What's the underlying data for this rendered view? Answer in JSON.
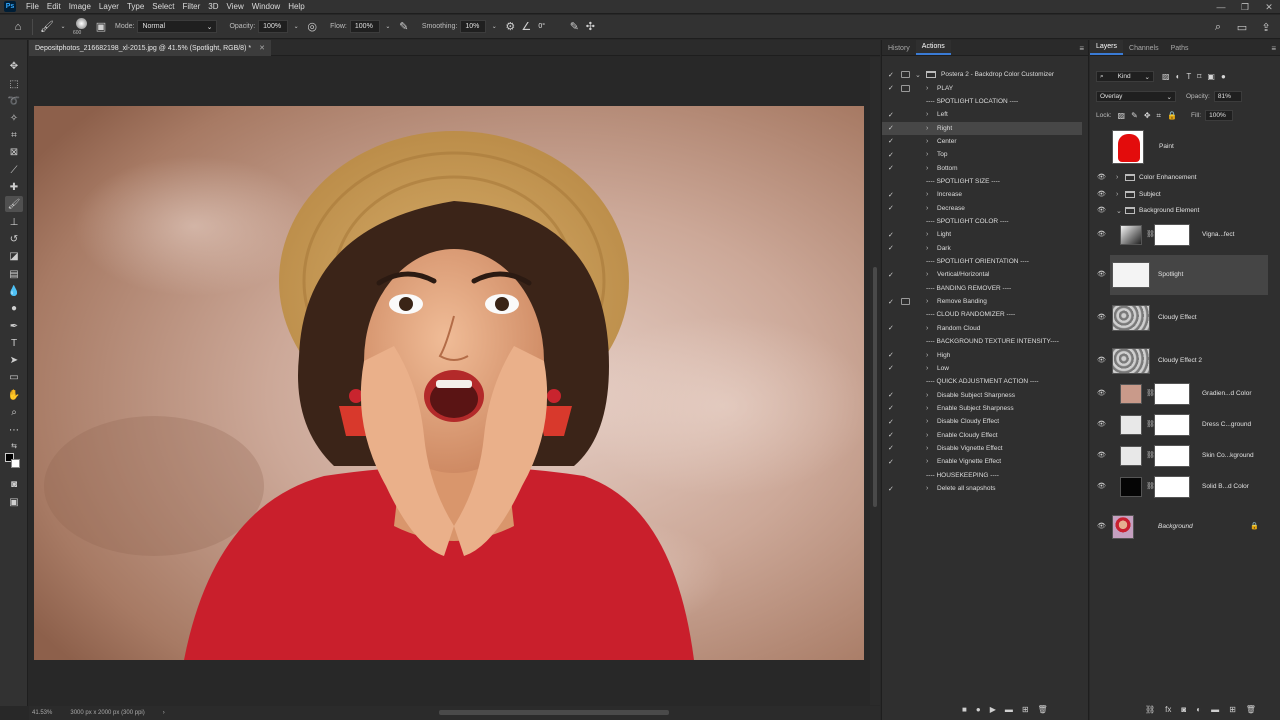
{
  "menubar": {
    "logo": "Ps",
    "items": [
      "File",
      "Edit",
      "Image",
      "Layer",
      "Type",
      "Select",
      "Filter",
      "3D",
      "View",
      "Window",
      "Help"
    ]
  },
  "options": {
    "brush_size": "600",
    "mode_label": "Mode:",
    "mode_value": "Normal",
    "opacity_label": "Opacity:",
    "opacity_value": "100%",
    "flow_label": "Flow:",
    "flow_value": "100%",
    "smoothing_label": "Smoothing:",
    "smoothing_value": "10%",
    "angle_value": "0°"
  },
  "document": {
    "tab_title": "Depositphotos_216682198_xl-2015.jpg @ 41.5% (Spotlight, RGB/8) *",
    "zoom": "41.53%",
    "doc_info": "3000 px x 2000 px (300 ppi)"
  },
  "actions_panel": {
    "tabs": [
      "History",
      "Actions"
    ],
    "set_name": "Postera 2 - Backdrop Color Customizer",
    "rows": [
      {
        "label": "PLAY",
        "type": "action",
        "checked": true,
        "dialog": true
      },
      {
        "label": "---- SPOTLIGHT LOCATION ----",
        "type": "section",
        "checked": false
      },
      {
        "label": "Left",
        "type": "action",
        "checked": true
      },
      {
        "label": "Right",
        "type": "action",
        "checked": true,
        "selected": true
      },
      {
        "label": "Center",
        "type": "action",
        "checked": true
      },
      {
        "label": "Top",
        "type": "action",
        "checked": true
      },
      {
        "label": "Bottom",
        "type": "action",
        "checked": true
      },
      {
        "label": "---- SPOTLIGHT SIZE ----",
        "type": "section",
        "checked": false
      },
      {
        "label": "Increase",
        "type": "action",
        "checked": true
      },
      {
        "label": "Decrease",
        "type": "action",
        "checked": true
      },
      {
        "label": "---- SPOTLIGHT COLOR ----",
        "type": "section",
        "checked": false
      },
      {
        "label": "Light",
        "type": "action",
        "checked": true
      },
      {
        "label": "Dark",
        "type": "action",
        "checked": true
      },
      {
        "label": "---- SPOTLIGHT ORIENTATION ----",
        "type": "section",
        "checked": false
      },
      {
        "label": "Vertical/Horizontal",
        "type": "action",
        "checked": true
      },
      {
        "label": "---- BANDING REMOVER ----",
        "type": "section",
        "checked": false
      },
      {
        "label": "Remove Banding",
        "type": "action",
        "checked": true,
        "dialog": true
      },
      {
        "label": "---- CLOUD RANDOMIZER ----",
        "type": "section",
        "checked": false
      },
      {
        "label": "Random Cloud",
        "type": "action",
        "checked": true
      },
      {
        "label": "---- BACKGROUND TEXTURE INTENSITY----",
        "type": "section",
        "checked": false
      },
      {
        "label": "High",
        "type": "action",
        "checked": true
      },
      {
        "label": "Low",
        "type": "action",
        "checked": true
      },
      {
        "label": "---- QUICK ADJUSTMENT ACTION ----",
        "type": "section",
        "checked": false
      },
      {
        "label": "Disable Subject Sharpness",
        "type": "action",
        "checked": true
      },
      {
        "label": "Enable Subject Sharpness",
        "type": "action",
        "checked": true
      },
      {
        "label": "Disable Cloudy Effect",
        "type": "action",
        "checked": true
      },
      {
        "label": "Enable Cloudy Effect",
        "type": "action",
        "checked": true
      },
      {
        "label": "Disable Vignette Effect",
        "type": "action",
        "checked": true
      },
      {
        "label": "Enable Vignette Effect",
        "type": "action",
        "checked": true
      },
      {
        "label": "---- HOUSEKEEPING ----",
        "type": "section",
        "checked": false
      },
      {
        "label": "Delete all snapshots",
        "type": "action",
        "checked": true
      }
    ]
  },
  "layers_panel": {
    "tabs": [
      "Layers",
      "Channels",
      "Paths"
    ],
    "filter_kind": "Kind",
    "blend_mode": "Overlay",
    "opacity_label": "Opacity:",
    "opacity_value": "81%",
    "lock_label": "Lock:",
    "fill_label": "Fill:",
    "fill_value": "100%",
    "layers": [
      {
        "name": "Paint",
        "kind": "paint"
      },
      {
        "name": "Color Enhancement",
        "kind": "group"
      },
      {
        "name": "Subject",
        "kind": "group"
      },
      {
        "name": "Background Element",
        "kind": "group-open"
      },
      {
        "name": "Vigna...fect",
        "kind": "masked"
      },
      {
        "name": "Spotlight",
        "kind": "smart",
        "selected": true
      },
      {
        "name": "Cloudy Effect",
        "kind": "cloud"
      },
      {
        "name": "Cloudy Effect 2",
        "kind": "cloud"
      },
      {
        "name": "Gradien...d Color",
        "kind": "masked",
        "tag": "#5a6aa8"
      },
      {
        "name": "Dress C...ground",
        "kind": "masked",
        "tag": "#4b7a3e"
      },
      {
        "name": "Skin Co...kground",
        "kind": "masked",
        "tag": "#b36a1c"
      },
      {
        "name": "Solid B...d Color",
        "kind": "masked",
        "tag": "#8a2b2b"
      },
      {
        "name": "Background",
        "kind": "background"
      }
    ]
  }
}
